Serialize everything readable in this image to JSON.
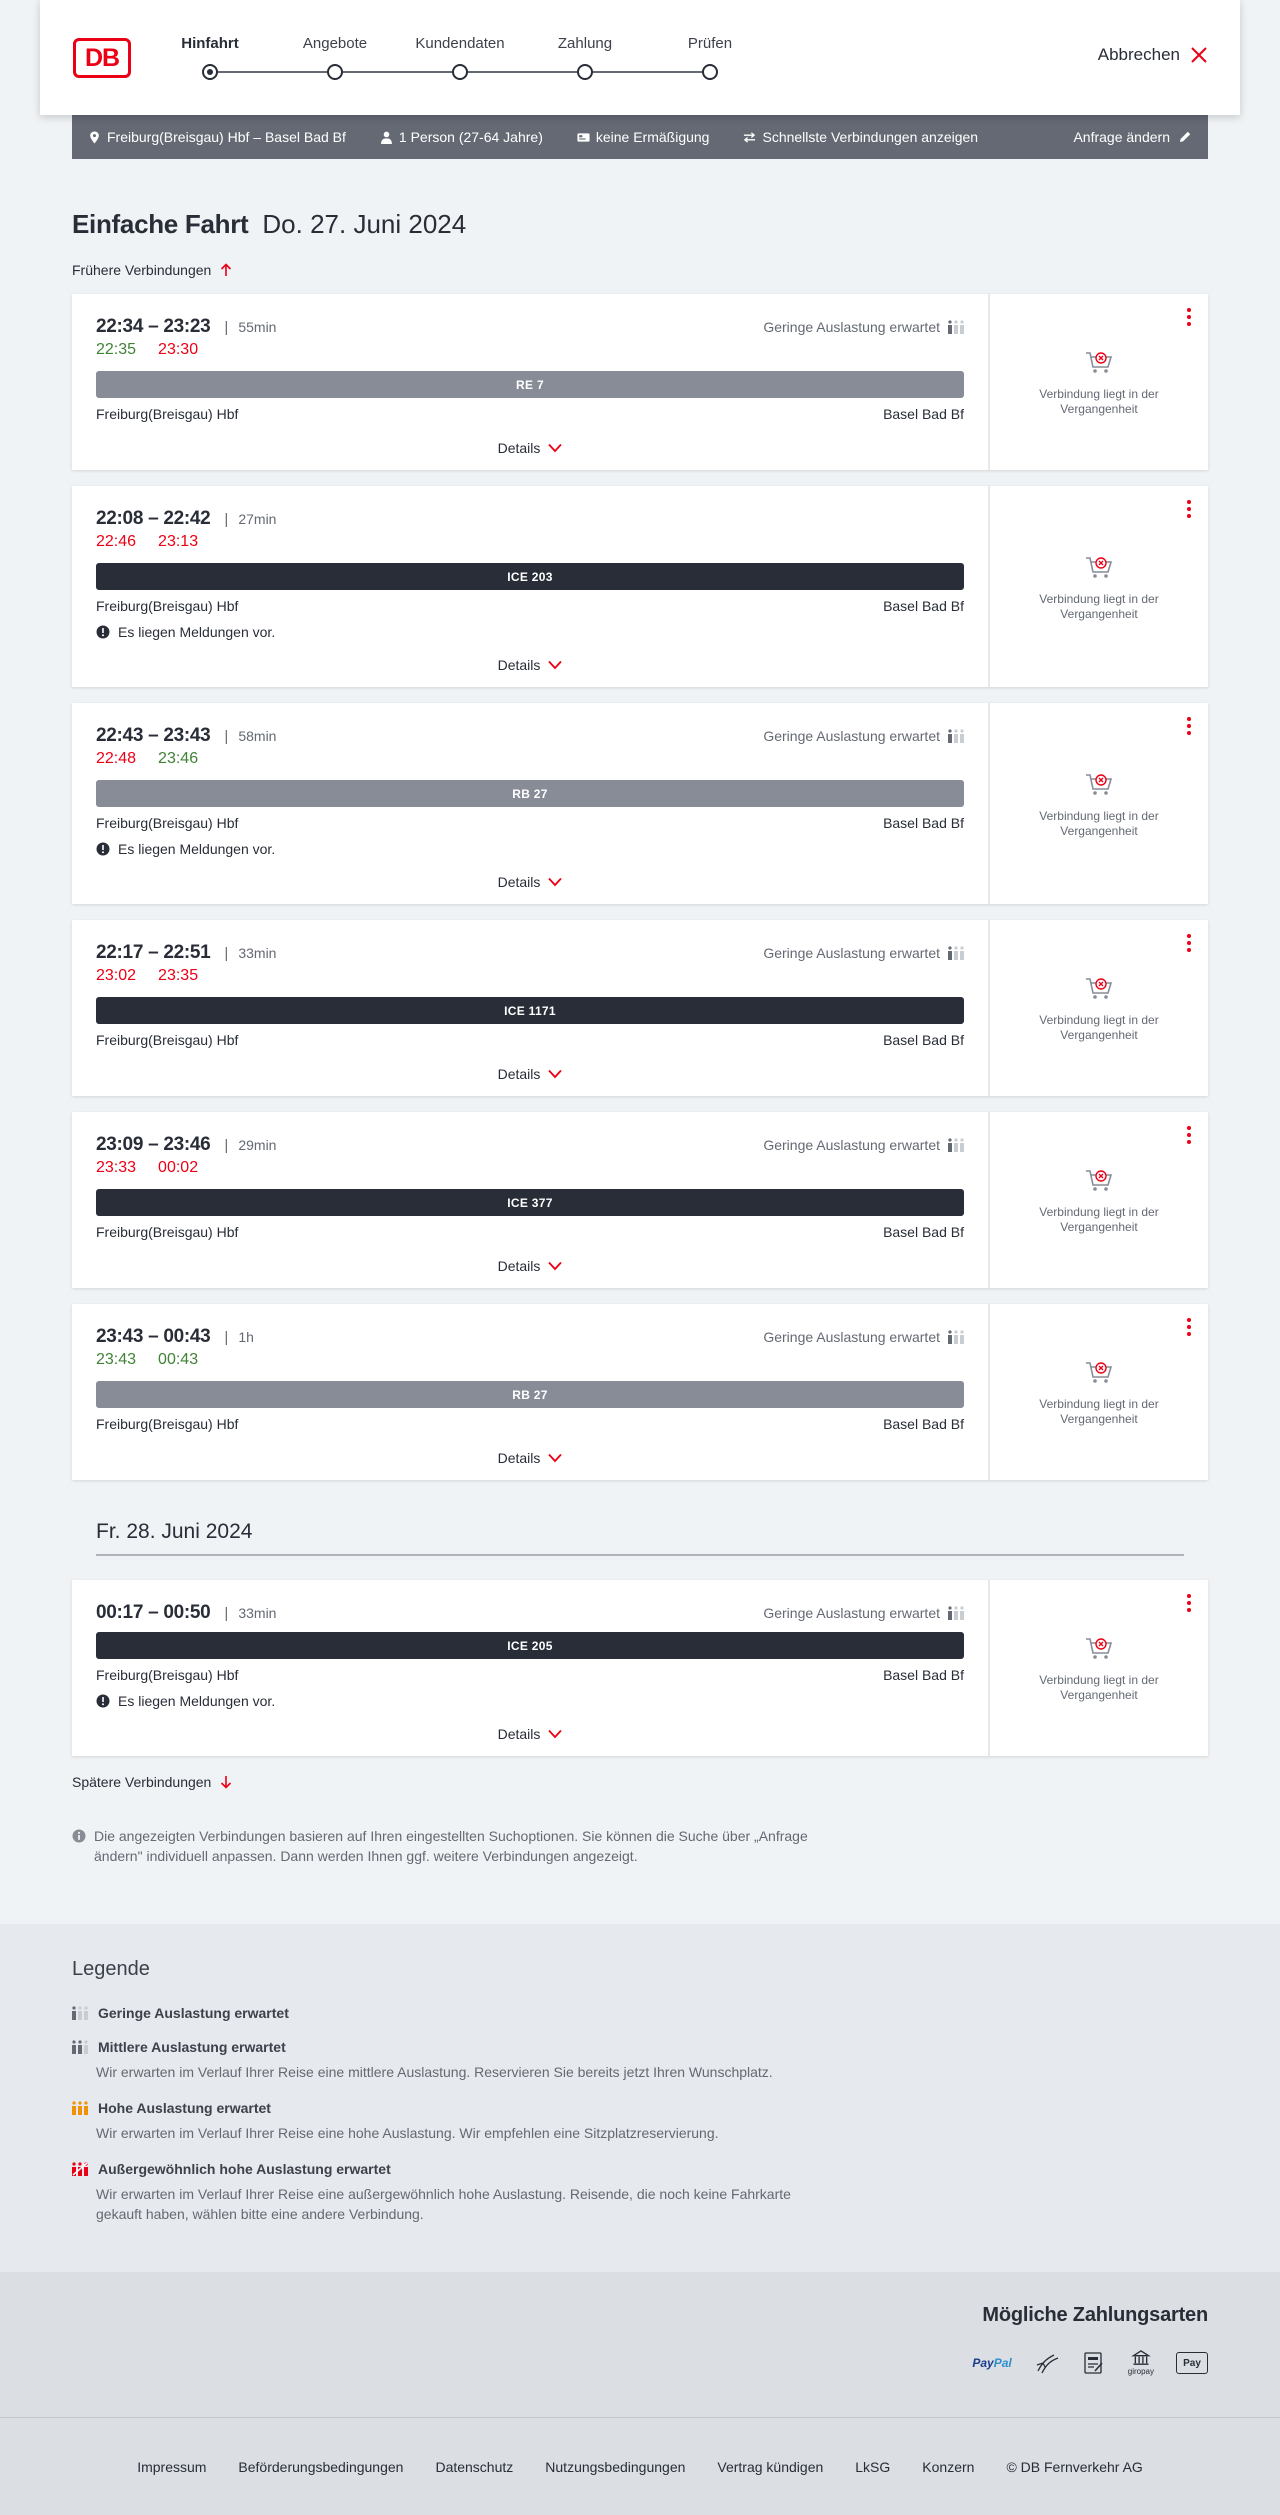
{
  "header": {
    "logo": "DB",
    "steps": [
      {
        "label": "Hinfahrt",
        "active": true
      },
      {
        "label": "Angebote",
        "active": false
      },
      {
        "label": "Kundendaten",
        "active": false
      },
      {
        "label": "Zahlung",
        "active": false
      },
      {
        "label": "Prüfen",
        "active": false
      }
    ],
    "cancel_label": "Abbrechen"
  },
  "query": {
    "route": "Freiburg(Breisgau) Hbf – Basel Bad Bf",
    "passengers": "1 Person (27-64 Jahre)",
    "discount": "keine Ermäßigung",
    "option": "Schnellste Verbindungen anzeigen",
    "edit_label": "Anfrage ändern"
  },
  "title": {
    "type": "Einfache Fahrt",
    "date": "Do. 27. Juni 2024"
  },
  "earlier_label": "Frühere Verbindungen",
  "later_label": "Spätere Verbindungen",
  "details_label": "Details",
  "past_label": "Verbindung liegt in der Vergangenheit",
  "load_label": "Geringe Auslastung erwartet",
  "connections": [
    {
      "times": "22:34 – 23:23",
      "duration": "55min",
      "rt_dep": "22:35",
      "rt_dep_status": "ok",
      "rt_arr": "23:30",
      "rt_arr_status": "late",
      "train": "RE 7",
      "train_class": "reg",
      "from": "Freiburg(Breisgau) Hbf",
      "to": "Basel Bad Bf",
      "load": true,
      "message": ""
    },
    {
      "times": "22:08 – 22:42",
      "duration": "27min",
      "rt_dep": "22:46",
      "rt_dep_status": "late",
      "rt_arr": "23:13",
      "rt_arr_status": "late",
      "train": "ICE 203",
      "train_class": "ice",
      "from": "Freiburg(Breisgau) Hbf",
      "to": "Basel Bad Bf",
      "load": false,
      "message": "Es liegen Meldungen vor."
    },
    {
      "times": "22:43 – 23:43",
      "duration": "58min",
      "rt_dep": "22:48",
      "rt_dep_status": "late",
      "rt_arr": "23:46",
      "rt_arr_status": "ok",
      "train": "RB 27",
      "train_class": "reg",
      "from": "Freiburg(Breisgau) Hbf",
      "to": "Basel Bad Bf",
      "load": true,
      "message": "Es liegen Meldungen vor."
    },
    {
      "times": "22:17 – 22:51",
      "duration": "33min",
      "rt_dep": "23:02",
      "rt_dep_status": "late",
      "rt_arr": "23:35",
      "rt_arr_status": "late",
      "train": "ICE 1171",
      "train_class": "ice",
      "from": "Freiburg(Breisgau) Hbf",
      "to": "Basel Bad Bf",
      "load": true,
      "message": ""
    },
    {
      "times": "23:09 – 23:46",
      "duration": "29min",
      "rt_dep": "23:33",
      "rt_dep_status": "late",
      "rt_arr": "00:02",
      "rt_arr_status": "late",
      "train": "ICE 377",
      "train_class": "ice",
      "from": "Freiburg(Breisgau) Hbf",
      "to": "Basel Bad Bf",
      "load": true,
      "message": ""
    },
    {
      "times": "23:43 – 00:43",
      "duration": "1h",
      "rt_dep": "23:43",
      "rt_dep_status": "ok",
      "rt_arr": "00:43",
      "rt_arr_status": "ok",
      "train": "RB 27",
      "train_class": "reg",
      "from": "Freiburg(Breisgau) Hbf",
      "to": "Basel Bad Bf",
      "load": true,
      "message": ""
    }
  ],
  "day2": {
    "heading": "Fr. 28. Juni 2024",
    "connections": [
      {
        "times": "00:17 – 00:50",
        "duration": "33min",
        "rt_dep": "",
        "rt_dep_status": "",
        "rt_arr": "",
        "rt_arr_status": "",
        "train": "ICE 205",
        "train_class": "ice",
        "from": "Freiburg(Breisgau) Hbf",
        "to": "Basel Bad Bf",
        "load": true,
        "message": "Es liegen Meldungen vor."
      }
    ]
  },
  "info_text": "Die angezeigten Verbindungen basieren auf Ihren eingestellten Suchoptionen. Sie können die Suche über „Anfrage ändern\" individuell anpassen. Dann werden Ihnen ggf. weitere Verbindungen angezeigt.",
  "legend": {
    "title": "Legende",
    "items": [
      {
        "title": "Geringe Auslastung erwartet",
        "desc": "",
        "level": 1
      },
      {
        "title": "Mittlere Auslastung erwartet",
        "desc": "Wir erwarten im Verlauf Ihrer Reise eine mittlere Auslastung. Reservieren Sie bereits jetzt Ihren Wunschplatz.",
        "level": 2
      },
      {
        "title": "Hohe Auslastung erwartet",
        "desc": "Wir erwarten im Verlauf Ihrer Reise eine hohe Auslastung. Wir empfehlen eine Sitzplatzreservierung.",
        "level": 3
      },
      {
        "title": "Außergewöhnlich hohe Auslastung erwartet",
        "desc": "Wir erwarten im Verlauf Ihrer Reise eine außergewöhnlich hohe Auslastung. Reisende, die noch keine Fahrkarte gekauft haben, wählen bitte eine andere Verbindung.",
        "level": 4
      }
    ]
  },
  "payments": {
    "title": "Mögliche Zahlungsarten",
    "methods": [
      "PayPal",
      "Kreditkarte",
      "SEPA Lastschrift",
      "giropay",
      "Apple Pay"
    ],
    "giropay_label": "giropay",
    "applepay_label": "Pay"
  },
  "footer": {
    "links": [
      "Impressum",
      "Beförderungsbedingungen",
      "Datenschutz",
      "Nutzungsbedingungen",
      "Vertrag kündigen",
      "LkSG",
      "Konzern",
      "© DB Fernverkehr AG"
    ]
  },
  "colors": {
    "brand_red": "#ec0016",
    "on_time_green": "#408335",
    "ice_bar": "#282d37",
    "regional_bar": "#878c96"
  }
}
